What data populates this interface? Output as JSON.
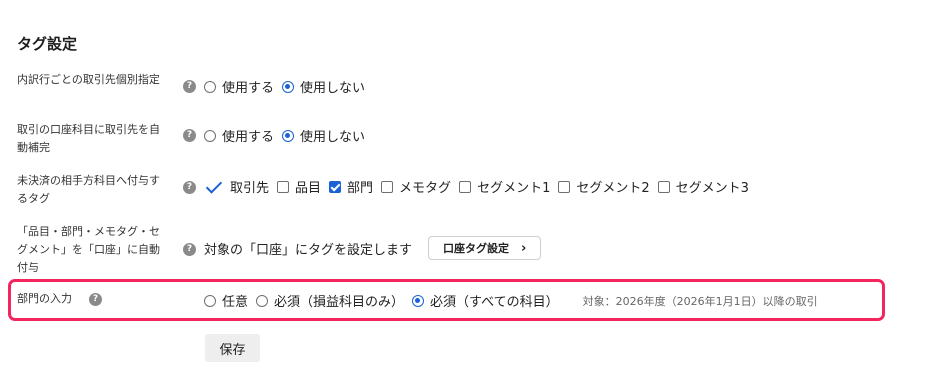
{
  "section_title": "タグ設定",
  "rows": {
    "row1": {
      "label": "内訳行ごとの取引先個別指定",
      "opt_use": "使用する",
      "opt_nouse": "使用しない",
      "selected": "使用しない"
    },
    "row2": {
      "label": "取引の口座科目に取引先を自動補完",
      "opt_use": "使用する",
      "opt_nouse": "使用しない",
      "selected": "使用しない"
    },
    "row3": {
      "label": "未決済の相手方科目へ付与するタグ",
      "fixed_label": "取引先",
      "checkboxes": [
        {
          "label": "品目",
          "checked": false
        },
        {
          "label": "部門",
          "checked": true
        },
        {
          "label": "メモタグ",
          "checked": false
        },
        {
          "label": "セグメント1",
          "checked": false
        },
        {
          "label": "セグメント2",
          "checked": false
        },
        {
          "label": "セグメント3",
          "checked": false
        }
      ]
    },
    "row4": {
      "label": "「品目・部門・メモタグ・セグメント」を「口座」に自動付与",
      "text": "対象の「口座」にタグを設定します",
      "button": "口座タグ設定",
      "button_icon": "chevron-right-icon"
    },
    "row5": {
      "label": "部門の入力",
      "opt_any": "任意",
      "opt_pl": "必須（損益科目のみ）",
      "opt_all": "必須（すべての科目）",
      "selected": "必須（すべての科目）",
      "note": "対象：2026年度（2026年1月1日）以降の取引"
    }
  },
  "help_glyph": "?",
  "save_label": "保存",
  "colors": {
    "accent": "#1a62d6",
    "highlight": "#f2255f",
    "help_icon": "#8a8a8a"
  }
}
